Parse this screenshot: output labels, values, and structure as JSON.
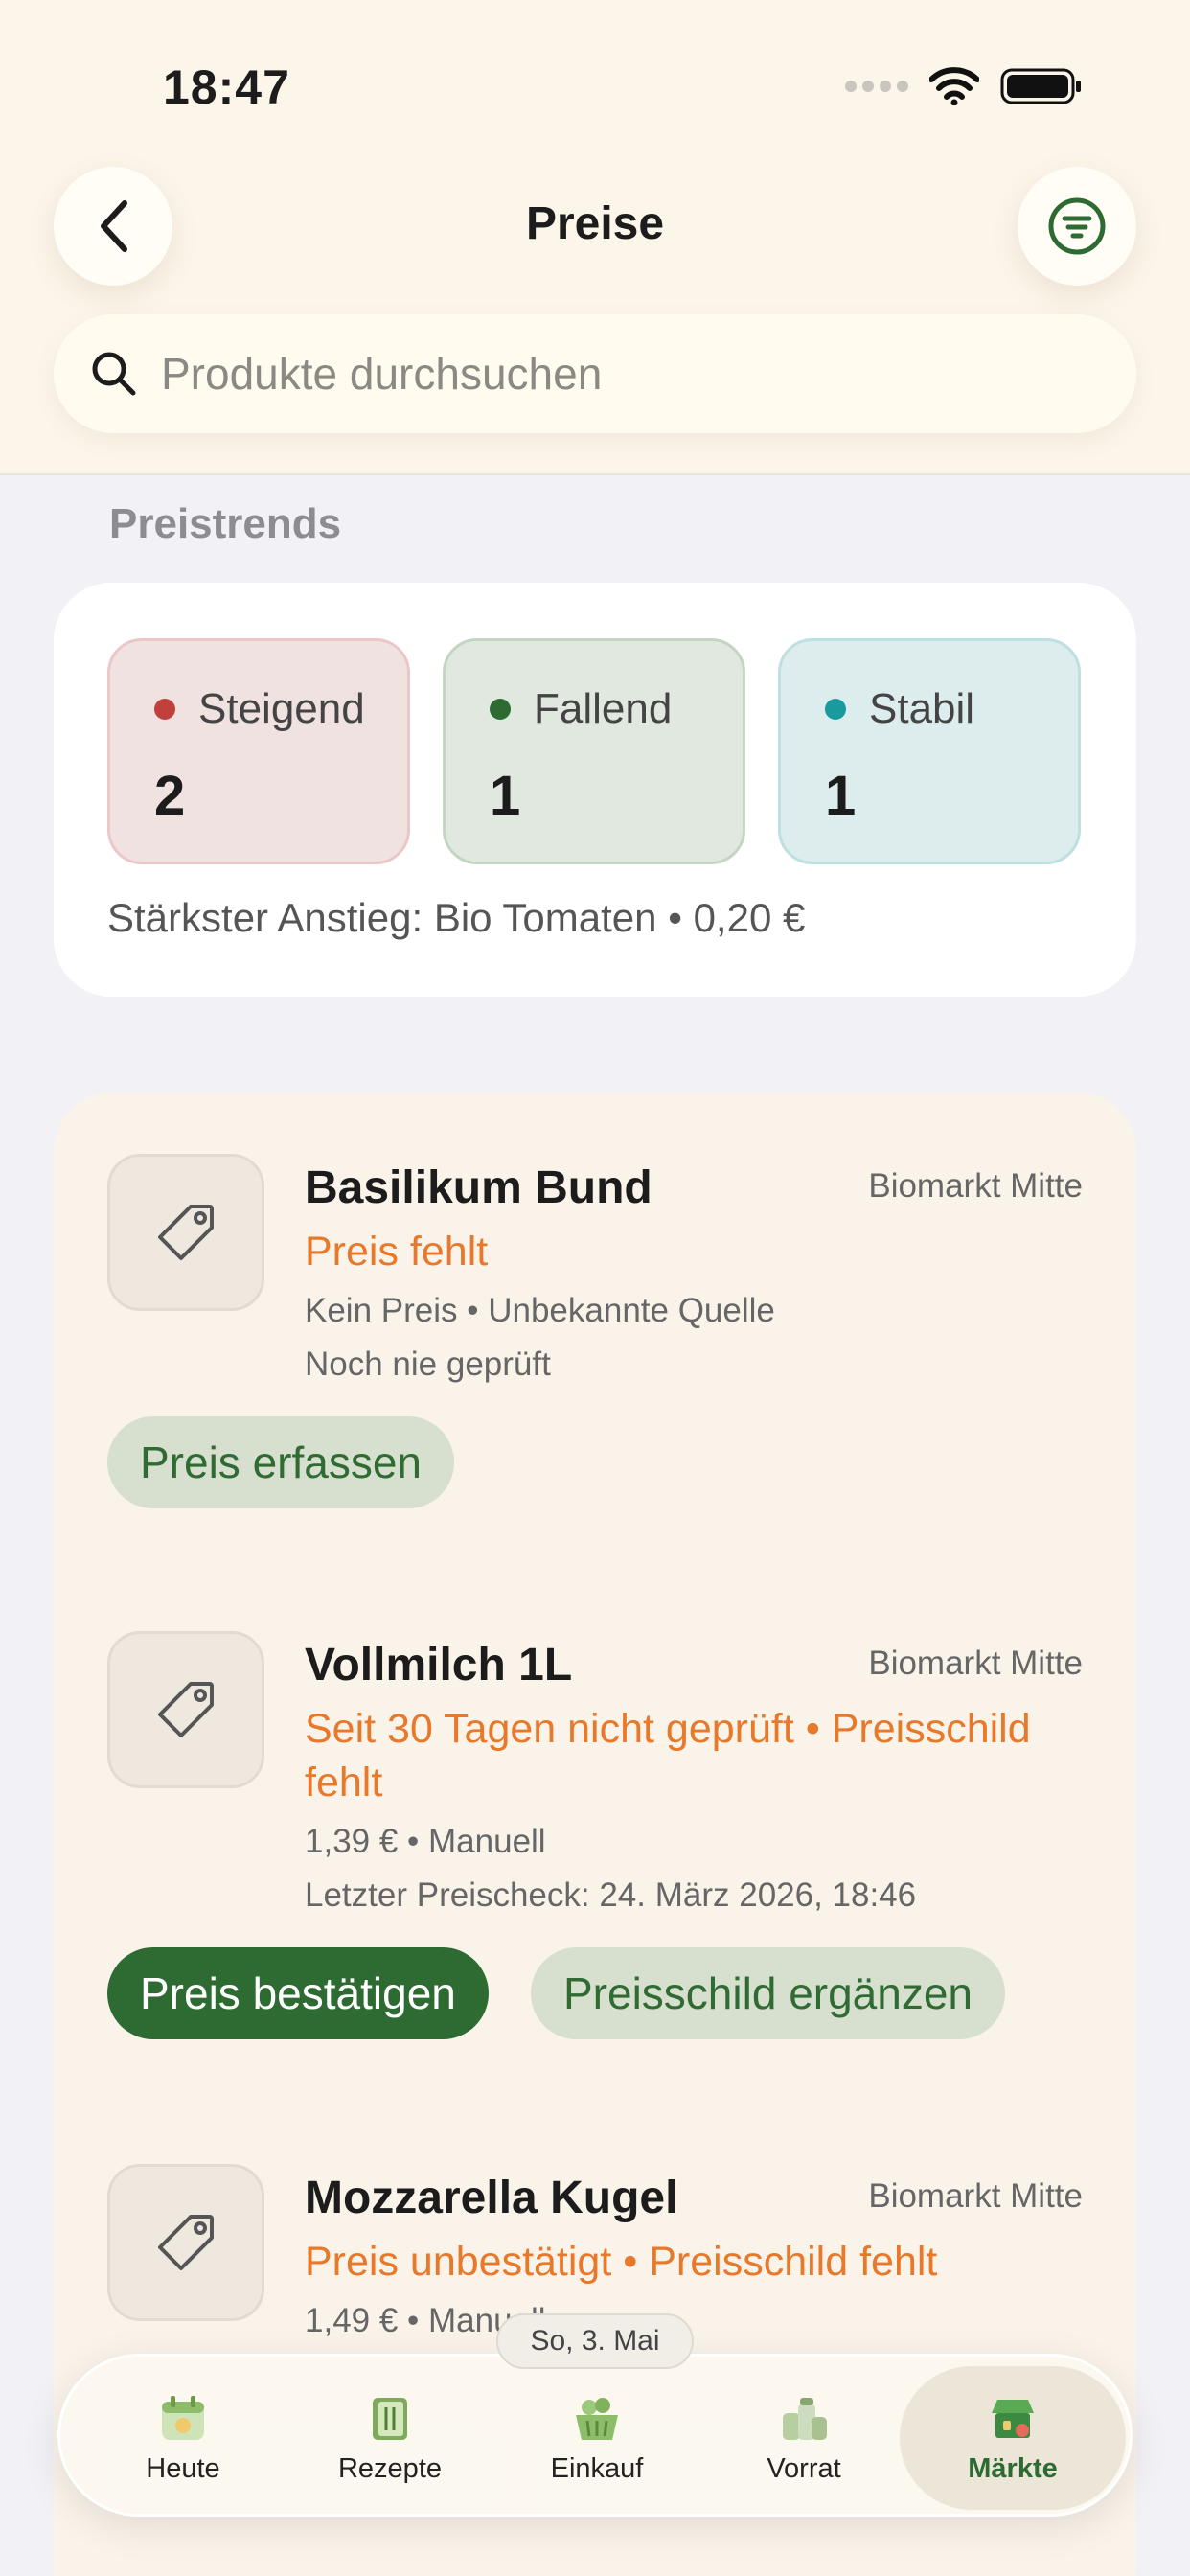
{
  "status": {
    "time": "18:47"
  },
  "header": {
    "title": "Preise",
    "search_placeholder": "Produkte durchsuchen"
  },
  "trends": {
    "section_title": "Preistrends",
    "rising": {
      "label": "Steigend",
      "count": "2",
      "color": "#c0413b"
    },
    "falling": {
      "label": "Fallend",
      "count": "1",
      "color": "#2e6b33"
    },
    "stable": {
      "label": "Stabil",
      "count": "1",
      "color": "#1a9a9c"
    },
    "note": "Stärkster Anstieg: Bio Tomaten • 0,20 €"
  },
  "items": [
    {
      "name": "Basilikum Bund",
      "market": "Biomarkt Mitte",
      "warning": "Preis fehlt",
      "meta1": "Kein Preis • Unbekannte Quelle",
      "meta2": "Noch nie geprüft",
      "button1": "Preis erfassen"
    },
    {
      "name": "Vollmilch 1L",
      "market": "Biomarkt Mitte",
      "warning": "Seit 30 Tagen nicht geprüft • Preisschild fehlt",
      "meta1": "1,39 € • Manuell",
      "meta2": "Letzter Preischeck: 24. März 2026, 18:46",
      "button1": "Preis bestätigen",
      "button2": "Preisschild ergänzen"
    },
    {
      "name": "Mozzarella Kugel",
      "market": "Biomarkt Mitte",
      "warning": "Preis unbestätigt • Preisschild fehlt",
      "meta1": "1,49 € • Manuell"
    }
  ],
  "date_chip": "So, 3. Mai",
  "tabs": [
    {
      "label": "Heute",
      "icon": "calendar-icon"
    },
    {
      "label": "Rezepte",
      "icon": "recipe-book-icon"
    },
    {
      "label": "Einkauf",
      "icon": "shopping-basket-icon"
    },
    {
      "label": "Vorrat",
      "icon": "pantry-jars-icon"
    },
    {
      "label": "Märkte",
      "icon": "market-stall-icon",
      "active": true
    }
  ],
  "colors": {
    "accent": "#2e6b33",
    "warning": "#e8782a",
    "header_bg": "#fcf5ea"
  }
}
